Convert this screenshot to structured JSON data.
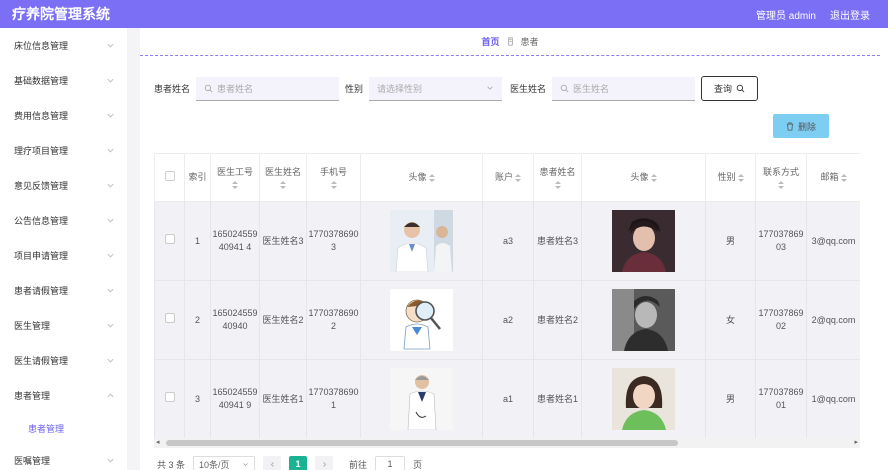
{
  "app": {
    "title": "疗养院管理系统",
    "user_label": "管理员 admin",
    "logout_label": "退出登录"
  },
  "sidebar": {
    "items": [
      {
        "label": "床位信息管理"
      },
      {
        "label": "基础数据管理"
      },
      {
        "label": "费用信息管理"
      },
      {
        "label": "理疗项目管理"
      },
      {
        "label": "意见反馈管理"
      },
      {
        "label": "公告信息管理"
      },
      {
        "label": "项目申请管理"
      },
      {
        "label": "患者请假管理"
      },
      {
        "label": "医生管理"
      },
      {
        "label": "医生请假管理"
      },
      {
        "label": "患者管理",
        "expanded": true
      }
    ],
    "sub_item": "患者管理",
    "last_item": "医嘱管理"
  },
  "breadcrumb": {
    "home": "首页",
    "current": "患者"
  },
  "search": {
    "patient_name_label": "患者姓名",
    "patient_name_placeholder": "患者姓名",
    "gender_label": "性别",
    "gender_placeholder": "请选择性别",
    "doctor_name_label": "医生姓名",
    "doctor_name_placeholder": "医生姓名",
    "query_label": "查询"
  },
  "actions": {
    "delete_label": "删除"
  },
  "table": {
    "headers": [
      "索引",
      "医生工号",
      "医生姓名",
      "手机号",
      "头像",
      "账户",
      "患者姓名",
      "头像",
      "性别",
      "联系方式",
      "邮箱"
    ],
    "rows": [
      {
        "index": "1",
        "doctor_id": "16502455940941 4",
        "doctor_name": "医生姓名3",
        "phone": "17703786903",
        "account": "a3",
        "patient_name": "患者姓名3",
        "gender": "男",
        "contact": "17703786903",
        "email": "3@qq.com"
      },
      {
        "index": "2",
        "doctor_id": "16502455940940",
        "doctor_name": "医生姓名2",
        "phone": "17703786902",
        "account": "a2",
        "patient_name": "患者姓名2",
        "gender": "女",
        "contact": "17703786902",
        "email": "2@qq.com"
      },
      {
        "index": "3",
        "doctor_id": "16502455940941 9",
        "doctor_name": "医生姓名1",
        "phone": "17703786901",
        "account": "a1",
        "patient_name": "患者姓名1",
        "gender": "男",
        "contact": "17703786901",
        "email": "1@qq.com"
      }
    ]
  },
  "pager": {
    "total": "共 3 条",
    "page_size": "10条/页",
    "current_page": "1",
    "goto_prefix": "前往",
    "goto_value": "1",
    "goto_suffix": "页"
  },
  "colors": {
    "header_bg": "#7b6ff5",
    "accent": "#6b5ff2",
    "delete_bg": "#7ecef4",
    "page_active": "#1ab394"
  }
}
